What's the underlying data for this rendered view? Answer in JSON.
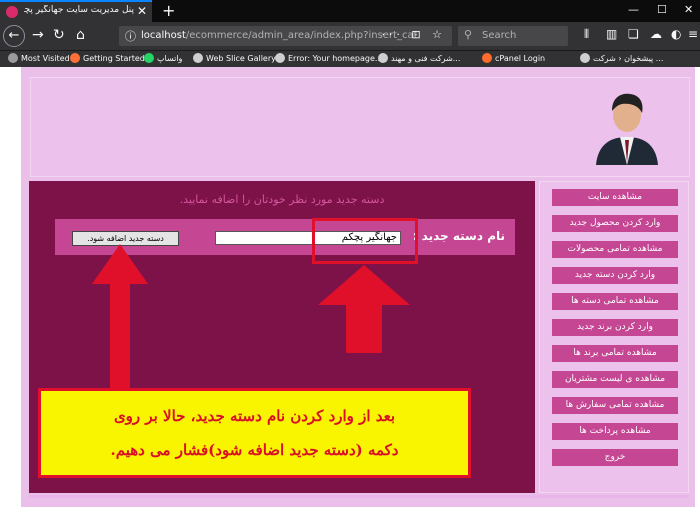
{
  "browser": {
    "tab_title": "پنل مدیریت سایت جهانگیر پچکم",
    "url_host": "localhost",
    "url_path": "/ecommerce/admin_area/index.php?insert_cat",
    "url_actions": "··· ⊡ ☆",
    "search_placeholder": "Search",
    "bookmarks": [
      {
        "label": "Most Visited",
        "color": "#9b9b9b"
      },
      {
        "label": "Getting Started",
        "color": "#ff7139"
      },
      {
        "label": "واتساپ",
        "color": "#25d366"
      },
      {
        "label": "Web Slice Gallery",
        "color": "#cfcfcf"
      },
      {
        "label": "Error: Your homepage...",
        "color": "#cfcfcf"
      },
      {
        "label": "شرکت فنی و مهند...",
        "color": "#cfcfcf"
      },
      {
        "label": "cPanel Login",
        "color": "#ff6c2c"
      },
      {
        "label": "پیشخوان ‹ شرکت ...",
        "color": "#cfcfcf"
      }
    ]
  },
  "main": {
    "title": "دسته جدید مورد نظر خودتان را اضافه نمایید.",
    "form_label": "نام دسته جدید :",
    "input_value": "جهانگیر پچکم",
    "submit_label": "دسته جدید اضافه شود."
  },
  "sidebar": {
    "items": [
      "مشاهده سایت",
      "وارد کردن محصول جدید",
      "مشاهده تمامی محصولات",
      "وارد کردن دسته جدید",
      "مشاهده تمامی دسته ها",
      "وارد کردن برند جدید",
      "مشاهده تمامی برند ها",
      "مشاهده ی لیست مشتریان",
      "مشاهده تمامی سفارش ها",
      "مشاهده پرداخت ها",
      "خروج"
    ]
  },
  "annotation": {
    "line1": "بعد از وارد کردن نام دسته جدید، حالا بر روی",
    "line2": "دکمه (دسته جدید اضافه شود)فشار می دهیم.",
    "color": "#e0102a",
    "box_color": "#f9f400"
  },
  "colors": {
    "accent": "#c54794",
    "main_bg": "#7d1248",
    "frame_bg": "#eabfea"
  }
}
